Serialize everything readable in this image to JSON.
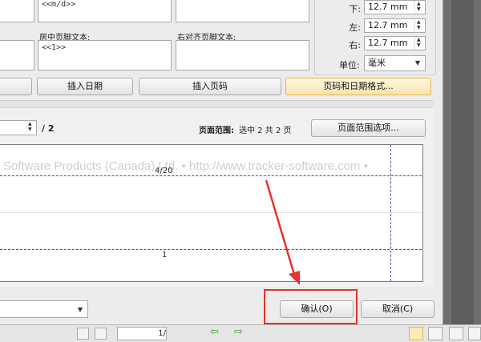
{
  "header_footer": {
    "top_left_text": "<<m/d>>",
    "center_footer_label": "居中页脚文本:",
    "center_footer_value": "<<1>>",
    "right_footer_label": "右对齐页脚文本:",
    "right_footer_value": ""
  },
  "margins": {
    "bottom_label": "下:",
    "bottom_value": "12.7 mm",
    "left_label": "左:",
    "left_value": "12.7 mm",
    "right_label": "右:",
    "right_value": "12.7 mm",
    "unit_label": "单位:",
    "unit_value": "毫米"
  },
  "buttons": {
    "insert_date": "插入日期",
    "insert_page_number": "插入页码",
    "page_date_format": "页码和日期格式...",
    "page_range_options": "页面范围选项...",
    "ok": "确认(O)",
    "cancel": "取消(C)"
  },
  "page_nav": {
    "total": "/ 2",
    "range_label": "页面范围:",
    "range_text": "选中 2 共 2 页"
  },
  "preview": {
    "watermark": "Software Products (Canada) Ltd. • http://www.tracker-software.com •",
    "header_text": "4/20",
    "footer_text": "1"
  },
  "status_bar": {
    "page_field": "1/"
  },
  "colors": {
    "highlight_border": "#e4b84a",
    "annotation_red": "#e8312a",
    "margin_guides": "#4a4ab8"
  }
}
